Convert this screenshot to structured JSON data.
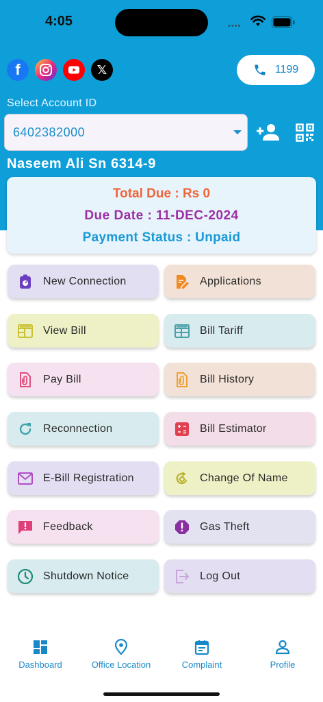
{
  "status_bar": {
    "time": "4:05",
    "dots": "••••"
  },
  "social": {
    "facebook": "f",
    "x": "𝕏"
  },
  "helpline": {
    "number": "1199"
  },
  "account": {
    "label": "Select Account ID",
    "selected": "6402382000",
    "customer_name": "Naseem Ali Sn 6314-9"
  },
  "due": {
    "total": "Total Due : Rs 0",
    "date": "Due Date : 11-DEC-2024",
    "status": "Payment Status : Unpaid"
  },
  "tiles": [
    {
      "label": "New Connection",
      "icon": "meter-icon",
      "bg": "#e3dff3",
      "color": "#6a3fc0"
    },
    {
      "label": "Applications",
      "icon": "document-edit-icon",
      "bg": "#f2e1d6",
      "color": "#f08a24"
    },
    {
      "label": "View Bill",
      "icon": "bill-icon",
      "bg": "#eef0c6",
      "color": "#c9c234"
    },
    {
      "label": "Bill Tariff",
      "icon": "tariff-icon",
      "bg": "#d8ebef",
      "color": "#4aa0a8"
    },
    {
      "label": "Pay Bill",
      "icon": "attach-icon",
      "bg": "#f5e1ef",
      "color": "#e0507c"
    },
    {
      "label": "Bill History",
      "icon": "history-icon",
      "bg": "#f2e1d6",
      "color": "#f0a030"
    },
    {
      "label": "Reconnection",
      "icon": "refresh-icon",
      "bg": "#d8ebef",
      "color": "#3fa3a8"
    },
    {
      "label": "Bill Estimator",
      "icon": "calculator-icon",
      "bg": "#f3dde8",
      "color": "#e04050"
    },
    {
      "label": "E-Bill Registration",
      "icon": "mail-icon",
      "bg": "#e4def3",
      "color": "#b04ec4"
    },
    {
      "label": "Change Of Name",
      "icon": "change-icon",
      "bg": "#eef0c6",
      "color": "#b8b430"
    },
    {
      "label": "Feedback",
      "icon": "feedback-icon",
      "bg": "#f5e1ef",
      "color": "#e0407a"
    },
    {
      "label": "Gas Theft",
      "icon": "alert-octagon-icon",
      "bg": "#e2e2f1",
      "color": "#8a2fa0"
    },
    {
      "label": "Shutdown Notice",
      "icon": "clock-icon",
      "bg": "#d8ebef",
      "color": "#1e8b78"
    },
    {
      "label": "Log Out",
      "icon": "logout-icon",
      "bg": "#e4def3",
      "color": "#c6a3db"
    }
  ],
  "nav": [
    {
      "label": "Dashboard",
      "icon": "dashboard-icon"
    },
    {
      "label": "Office Location",
      "icon": "location-icon"
    },
    {
      "label": "Complaint",
      "icon": "calendar-icon"
    },
    {
      "label": "Profile",
      "icon": "profile-icon"
    }
  ],
  "colors": {
    "header": "#0f9fd8",
    "accent": "#1789c9"
  }
}
